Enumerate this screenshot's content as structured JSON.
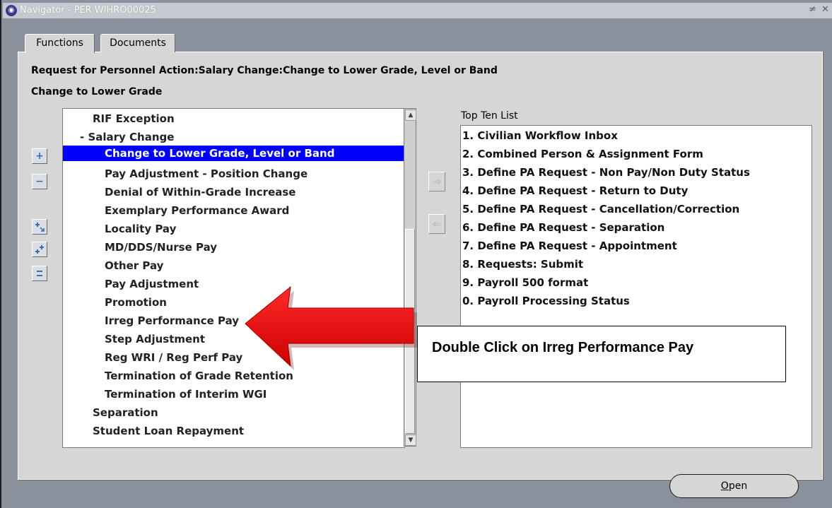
{
  "window": {
    "title": "Navigator - PER WIHRO00025",
    "controls": "≠ ✕"
  },
  "tabs": [
    {
      "label": "Functions",
      "active": true
    },
    {
      "label": "Documents",
      "active": false
    }
  ],
  "headings": {
    "path": "Request for Personnel Action:Salary Change:Change to Lower Grade, Level or Band",
    "selected": "Change to Lower Grade"
  },
  "tree": {
    "items": [
      {
        "label": "RIF Exception"
      },
      {
        "label": "-  Salary Change"
      },
      {
        "label": "Change to Lower Grade, Level or Band",
        "selected": true
      },
      {
        "label": "Pay Adjustment - Position Change"
      },
      {
        "label": "Denial of Within-Grade Increase"
      },
      {
        "label": "Exemplary Performance Award"
      },
      {
        "label": "Locality Pay"
      },
      {
        "label": "MD/DDS/Nurse Pay"
      },
      {
        "label": "Other Pay"
      },
      {
        "label": "Pay Adjustment"
      },
      {
        "label": "Promotion"
      },
      {
        "label": "Irreg Performance Pay"
      },
      {
        "label": "Step Adjustment"
      },
      {
        "label": "Reg WRI / Reg Perf Pay"
      },
      {
        "label": "Termination of Grade Retention"
      },
      {
        "label": "Termination of Interim WGI"
      },
      {
        "label": "Separation"
      },
      {
        "label": "Student Loan Repayment"
      }
    ]
  },
  "side_buttons": {
    "expand": "+",
    "collapse": "−",
    "expand_branch_icon": "expand-branch-icon",
    "expand_all_icon": "expand-all-icon",
    "collapse_all_icon": "collapse-all-icon"
  },
  "top_ten": {
    "label": "Top Ten List",
    "items": [
      "1. Civilian Workflow Inbox",
      "2. Combined Person & Assignment Form",
      "3. Define PA Request - Non Pay/Non Duty Status",
      "4. Define PA Request - Return to Duty",
      "5. Define PA Request - Cancellation/Correction",
      "6. Define PA Request - Separation",
      "7. Define PA Request - Appointment",
      "8. Requests: Submit",
      "9. Payroll 500 format",
      "0. Payroll Processing Status"
    ]
  },
  "callout": {
    "text": "Double Click on Irreg Performance Pay",
    "arrow_color": "#ff0000"
  },
  "buttons": {
    "open": "Open",
    "add_arrow": "⇒",
    "remove_arrow": "⇐"
  },
  "colors": {
    "selection": "#0000ff",
    "panel": "#d6d6d6"
  }
}
